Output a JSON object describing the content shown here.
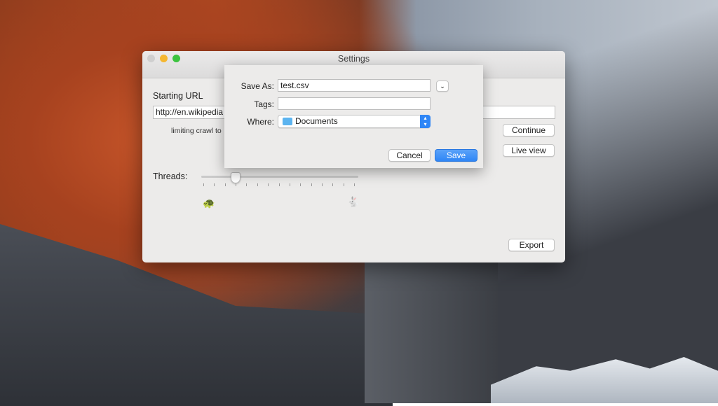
{
  "window": {
    "title": "Settings"
  },
  "main": {
    "starting_url_label": "Starting URL",
    "url_value": "http://en.wikipedia",
    "limit_text": "limiting crawl to",
    "continue_label": "Continue",
    "live_view_label": "Live view",
    "threads_label": "Threads:",
    "threads_slider": {
      "min": 1,
      "max": 15,
      "value": 4
    },
    "export_label": "Export"
  },
  "sheet": {
    "save_as_label": "Save As:",
    "save_as_value": "test.csv",
    "tags_label": "Tags:",
    "tags_value": "",
    "where_label": "Where:",
    "where_value": "Documents",
    "cancel_label": "Cancel",
    "save_label": "Save",
    "accent": "#2f86f6"
  }
}
